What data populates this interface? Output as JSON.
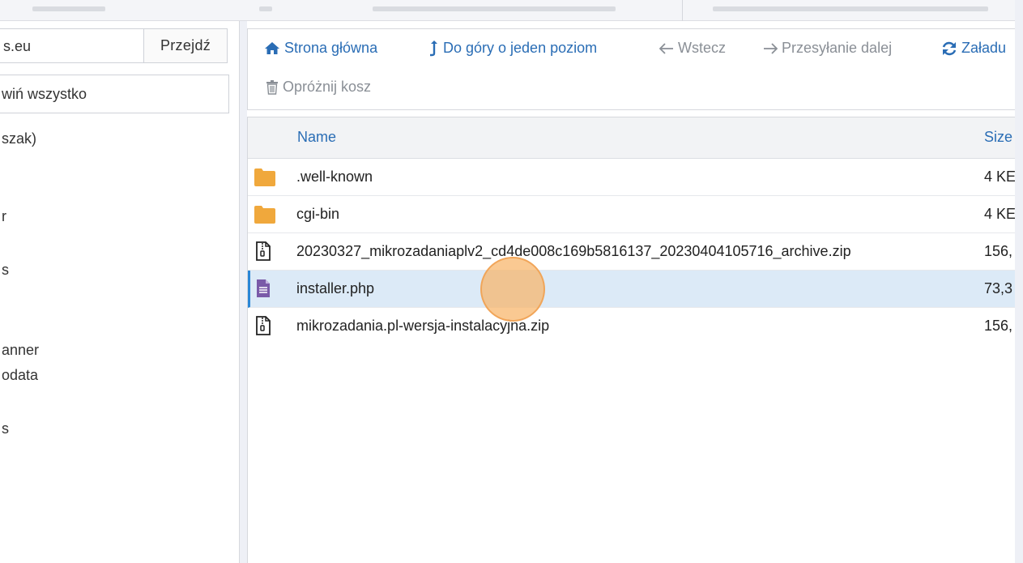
{
  "sidebar": {
    "path_value": "s.eu",
    "go_label": "Przejdź",
    "collapse_label": "wiń wszystko",
    "tree": [
      "szak)",
      "r",
      "s",
      "anner",
      "odata",
      "s"
    ]
  },
  "toolbar": {
    "home": "Strona główna",
    "up": "Do góry o jeden poziom",
    "back": "Wstecz",
    "forward": "Przesyłanie dalej",
    "reload": "Załadu",
    "empty_trash": "Opróżnij kosz"
  },
  "table": {
    "headers": {
      "name": "Name",
      "size": "Size"
    },
    "rows": [
      {
        "name": ".well-known",
        "size": "4 KE",
        "icon": "folder-icon"
      },
      {
        "name": "cgi-bin",
        "size": "4 KE",
        "icon": "folder-icon"
      },
      {
        "name": "20230327_mikrozadaniaplv2_cd4de008c169b5816137_20230404105716_archive.zip",
        "size": "156,",
        "icon": "zip-file-icon"
      },
      {
        "name": "installer.php",
        "size": "73,3",
        "icon": "php-file-icon"
      },
      {
        "name": "mikrozadania.pl-wersja-instalacyjna.zip",
        "size": "156,",
        "icon": "zip-file-icon"
      }
    ]
  },
  "colors": {
    "link": "#2a6db5",
    "folder": "#f0a83c",
    "php_icon": "#7a5aa8",
    "selected_row": "#dceaf7",
    "click_marker": "#f8b468"
  }
}
